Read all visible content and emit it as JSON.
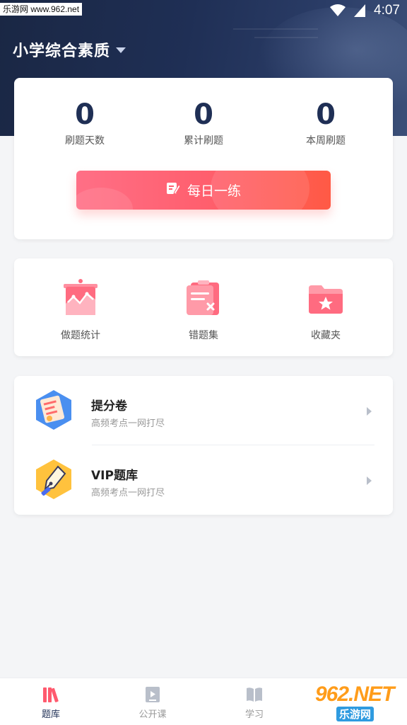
{
  "status_bar": {
    "watermark": "乐游网 www.962.net",
    "time": "4:07"
  },
  "header": {
    "title": "小学综合素质"
  },
  "stats": [
    {
      "value": "0",
      "label": "刷题天数"
    },
    {
      "value": "0",
      "label": "累计刷题"
    },
    {
      "value": "0",
      "label": "本周刷题"
    }
  ],
  "daily_button": {
    "label": "每日一练"
  },
  "tools": [
    {
      "label": "做题统计",
      "icon": "chart-icon"
    },
    {
      "label": "错题集",
      "icon": "wrong-questions-icon"
    },
    {
      "label": "收藏夹",
      "icon": "favorites-folder-icon"
    }
  ],
  "list": [
    {
      "title": "提分卷",
      "subtitle": "高频考点一网打尽",
      "icon": "exam-paper-icon"
    },
    {
      "title": "VIP题库",
      "subtitle": "高频考点一网打尽",
      "icon": "pen-nib-icon"
    }
  ],
  "tabs": [
    {
      "label": "题库",
      "icon": "books-icon",
      "active": true
    },
    {
      "label": "公开课",
      "icon": "video-icon",
      "active": false
    },
    {
      "label": "学习",
      "icon": "open-book-icon",
      "active": false
    }
  ],
  "brand_watermark": {
    "big": "962.NET",
    "small": "乐游网"
  },
  "colors": {
    "navy": "#1f2f55",
    "accent_red": "#ff5f6e",
    "background": "#f4f5f7"
  }
}
